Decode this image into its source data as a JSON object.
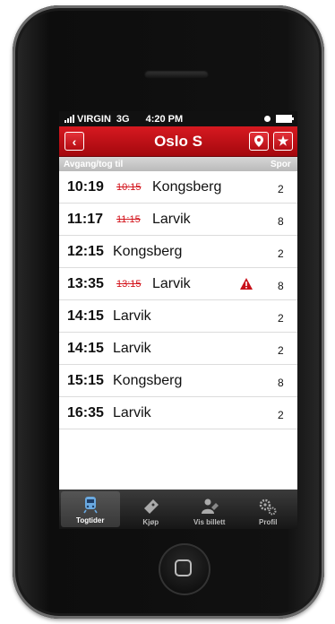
{
  "status_bar": {
    "carrier": "VIRGIN",
    "network": "3G",
    "time": "4:20 PM"
  },
  "nav": {
    "title": "Oslo S",
    "back_icon": "chevron-left-icon",
    "pin_icon": "location-pin-icon",
    "star_icon": "star-icon"
  },
  "columns": {
    "departure": "Avgang/tog til",
    "track": "Spor"
  },
  "departures": [
    {
      "time": "10:19",
      "old_time": "10:15",
      "destination": "Kongsberg",
      "track": "2",
      "warning": false
    },
    {
      "time": "11:17",
      "old_time": "11:15",
      "destination": "Larvik",
      "track": "8",
      "warning": false
    },
    {
      "time": "12:15",
      "old_time": "",
      "destination": "Kongsberg",
      "track": "2",
      "warning": false
    },
    {
      "time": "13:35",
      "old_time": "13:15",
      "destination": "Larvik",
      "track": "8",
      "warning": true
    },
    {
      "time": "14:15",
      "old_time": "",
      "destination": "Larvik",
      "track": "2",
      "warning": false
    },
    {
      "time": "14:15",
      "old_time": "",
      "destination": "Larvik",
      "track": "2",
      "warning": false
    },
    {
      "time": "15:15",
      "old_time": "",
      "destination": "Kongsberg",
      "track": "8",
      "warning": false
    },
    {
      "time": "16:35",
      "old_time": "",
      "destination": "Larvik",
      "track": "2",
      "warning": false
    }
  ],
  "tabs": [
    {
      "label": "Togtider",
      "icon": "train-icon",
      "active": true
    },
    {
      "label": "Kjøp",
      "icon": "ticket-icon",
      "active": false
    },
    {
      "label": "Vis billett",
      "icon": "person-ticket-icon",
      "active": false
    },
    {
      "label": "Profil",
      "icon": "gears-icon",
      "active": false
    }
  ],
  "colors": {
    "accent": "#c8101a",
    "delay": "#d3141c",
    "tabbar": "#1e1e1e"
  }
}
